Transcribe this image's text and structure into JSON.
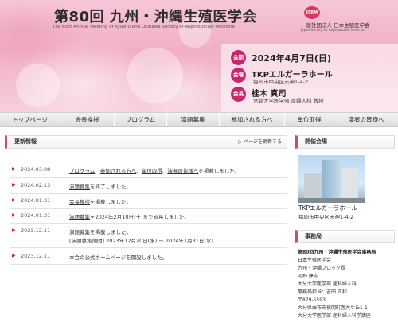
{
  "header": {
    "title": "第80回 九州・沖縄生殖医学会",
    "subtitle": "The 80th Annual Meeting of Kyushu and Okinawa Society of Reproductive Medicine",
    "logo": {
      "mark": "JSRM",
      "name_jp": "一般社団法人 日本生殖医学会",
      "name_en": "Japan Society for Reproductive Medicine"
    },
    "info": [
      {
        "badge": "会期",
        "main": "2024年4月7日(日)",
        "sub": ""
      },
      {
        "badge": "会場",
        "main": "TKPエルガーラホール",
        "sub": "福岡市中央区天神1-4-2"
      },
      {
        "badge": "会長",
        "main": "桂木 真司",
        "sub": "宮崎大学医学部 産婦人科 教授"
      }
    ]
  },
  "nav": {
    "items": [
      {
        "label": "トップページ"
      },
      {
        "label": "会長挨拶"
      },
      {
        "label": "プログラム"
      },
      {
        "label": "演題募集"
      },
      {
        "label": "参加される方へ"
      },
      {
        "label": "単位取得"
      },
      {
        "label": "演者の皆様へ"
      }
    ]
  },
  "news": {
    "heading": "更新情報",
    "more_link": "▷ ページを更新する",
    "items": [
      {
        "date": "2024.03.08",
        "segments": [
          {
            "text": "プログラム",
            "link": true
          },
          {
            "text": "、",
            "link": false
          },
          {
            "text": "参加される方へ",
            "link": true
          },
          {
            "text": "、",
            "link": false
          },
          {
            "text": "単位取得",
            "link": true
          },
          {
            "text": "、",
            "link": false
          },
          {
            "text": "演者の皆様へ",
            "link": true
          },
          {
            "text": "を掲載しました。",
            "link": false
          }
        ],
        "sub": ""
      },
      {
        "date": "2024.02.13",
        "segments": [
          {
            "text": "演題募集",
            "link": true
          },
          {
            "text": "を終了しました。",
            "link": false
          }
        ],
        "sub": ""
      },
      {
        "date": "2024.01.31",
        "segments": [
          {
            "text": "会長挨拶",
            "link": true
          },
          {
            "text": "を掲載しました。",
            "link": false
          }
        ],
        "sub": ""
      },
      {
        "date": "2024.01.31",
        "segments": [
          {
            "text": "演題募集",
            "link": true
          },
          {
            "text": "を2024年2月10日(土)まで延長しました。",
            "link": false
          }
        ],
        "sub": ""
      },
      {
        "date": "2023.12.11",
        "segments": [
          {
            "text": "演題募集",
            "link": true
          },
          {
            "text": "を掲載しました。",
            "link": false
          }
        ],
        "sub": "[演題募集期間] 2023年12月20日(水) ～ 2024年1月31日(水)"
      },
      {
        "date": "2023.12.11",
        "segments": [
          {
            "text": "本会の公式ホームページを開設しました。",
            "link": false
          }
        ],
        "sub": ""
      }
    ]
  },
  "venue": {
    "heading": "開催会場",
    "name": "TKPエルガーラホール",
    "address": "福岡市中央区天神1-4-2"
  },
  "office": {
    "heading": "事務局",
    "lines": [
      "第80回九州・沖縄生殖医学会事務局",
      "日本生殖医学会",
      "九州・沖縄ブロック長",
      "河野 康志",
      "大分大学医学部 産科婦人科",
      "事務局担当：吉田 正和",
      "〒879-5593",
      "大分県由布市挾間町医大ケ丘1-1",
      "大分大学医学部 産科婦人科学講座"
    ]
  },
  "colors": {
    "accent": "#c9266c",
    "header_pink": "#f1afc6",
    "nav_bg": "#e6e6e6"
  }
}
